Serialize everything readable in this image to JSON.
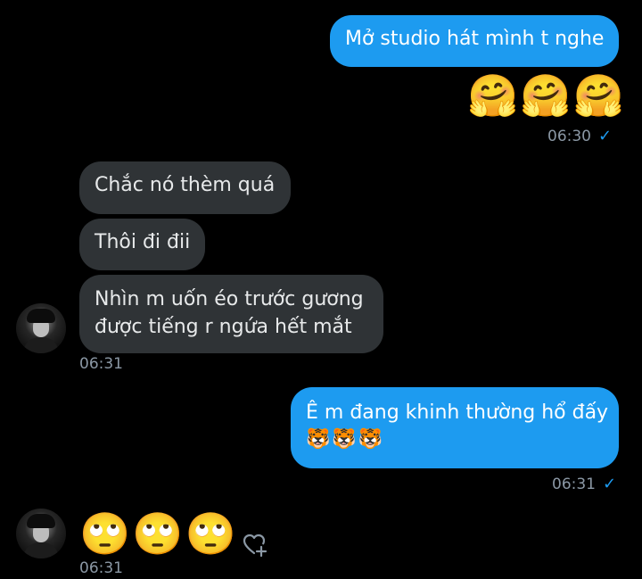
{
  "messages": [
    {
      "id": "m1",
      "direction": "out",
      "text": "Mở studio hát mình t nghe"
    },
    {
      "id": "m2",
      "direction": "out",
      "emoji": "🤗🤗🤗"
    },
    {
      "id": "t1",
      "time": "06:30",
      "status": "read"
    },
    {
      "id": "m3",
      "direction": "in",
      "text": "Chắc nó thèm quá"
    },
    {
      "id": "m4",
      "direction": "in",
      "text": "Thôi đi đii"
    },
    {
      "id": "m5",
      "direction": "in",
      "lines": [
        "Nhìn m uốn éo trước gương",
        "được tiếng r ngứa hết mắt"
      ]
    },
    {
      "id": "t2",
      "time": "06:31"
    },
    {
      "id": "m6",
      "direction": "out",
      "lines": [
        "Ê m đang khinh thường hổ đấy",
        "🐯🐯🐯"
      ]
    },
    {
      "id": "t3",
      "time": "06:31",
      "status": "read"
    },
    {
      "id": "m7",
      "direction": "in",
      "emoji": "🙄🙄🙄"
    },
    {
      "id": "t4",
      "time": "06:31"
    }
  ],
  "icons": {
    "read": "check-icon",
    "react": "heart-add-icon",
    "avatar": "contact-avatar"
  },
  "colors": {
    "outgoing": "#1d9bf0",
    "incoming": "#2f3336",
    "background": "#000000",
    "timestamp": "#8b98a5"
  }
}
